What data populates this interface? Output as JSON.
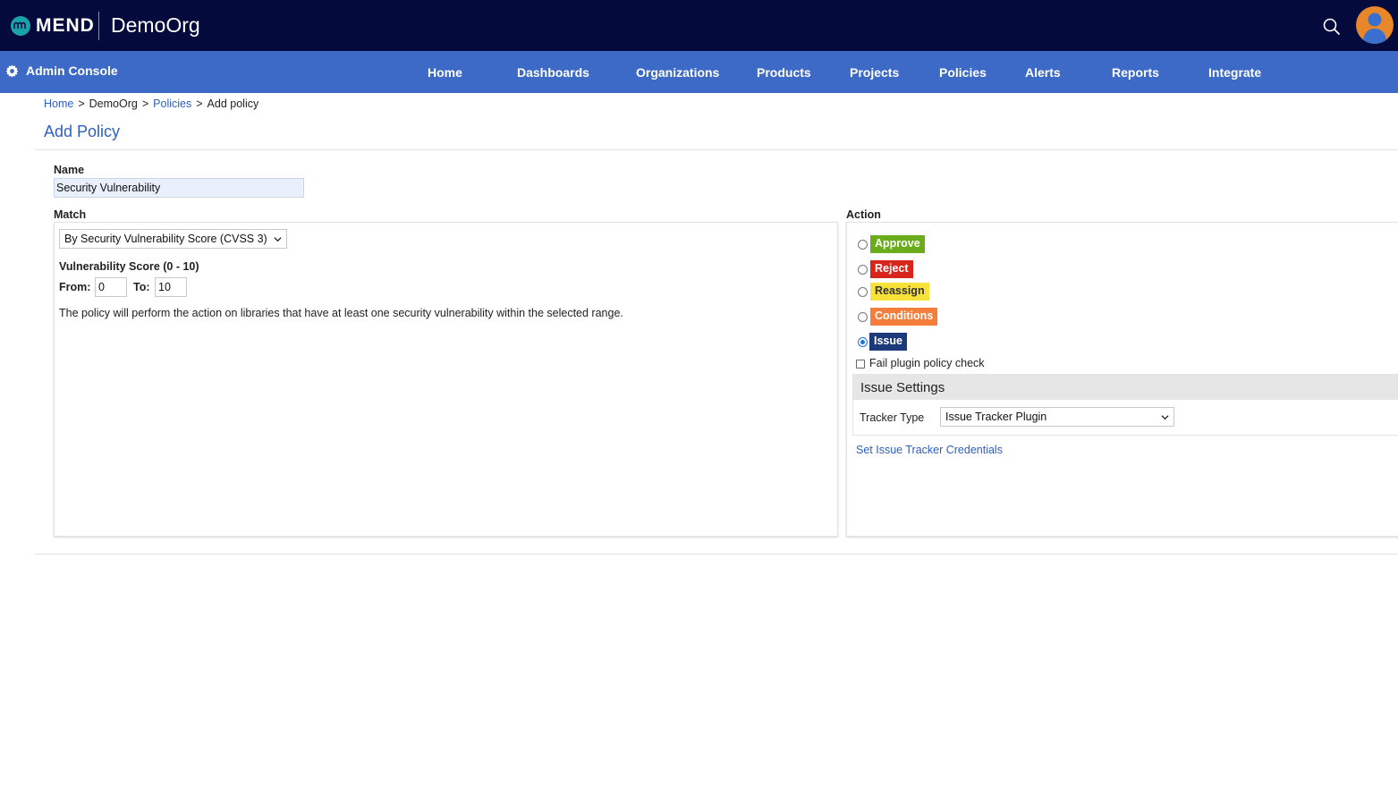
{
  "header": {
    "logo_text": "MEND",
    "org_name": "DemoOrg"
  },
  "navbar": {
    "admin_label": "Admin Console",
    "items": [
      "Home",
      "Dashboards",
      "Organizations",
      "Products",
      "Projects",
      "Policies",
      "Alerts",
      "Reports",
      "Integrate"
    ]
  },
  "breadcrumb": {
    "items": [
      "Home",
      "DemoOrg",
      "Policies",
      "Add policy"
    ],
    "separator": ">"
  },
  "page": {
    "title": "Add Policy"
  },
  "form": {
    "name_label": "Name",
    "name_value": "Security Vulnerability",
    "match_label": "Match",
    "match_select": "By Security Vulnerability Score (CVSS 3)",
    "score_label": "Vulnerability Score (0 - 10)",
    "from_label": "From:",
    "from_value": "0",
    "to_label": "To:",
    "to_value": "10",
    "description": "The policy will perform the action on libraries that have at least one security vulnerability within the selected range."
  },
  "action": {
    "label": "Action",
    "options": [
      {
        "label": "Approve",
        "color": "#6aac1a",
        "text_color": "#ffffff",
        "selected": false
      },
      {
        "label": "Reject",
        "color": "#d8261c",
        "text_color": "#ffffff",
        "selected": false
      },
      {
        "label": "Reassign",
        "color": "#f7e23a",
        "text_color": "#333333",
        "selected": false
      },
      {
        "label": "Conditions",
        "color": "#f57f3a",
        "text_color": "#ffffff",
        "selected": false
      },
      {
        "label": "Issue",
        "color": "#1c3a7a",
        "text_color": "#ffffff",
        "selected": true
      }
    ],
    "fail_check_label": "Fail plugin policy check",
    "fail_check_checked": false
  },
  "issue_settings": {
    "title": "Issue Settings",
    "tracker_label": "Tracker Type",
    "tracker_value": "Issue Tracker Plugin",
    "credentials_link": "Set Issue Tracker Credentials"
  },
  "colors": {
    "topbar": "#050a3c",
    "navbar": "#3d6ac6",
    "link": "#2f5fbf"
  }
}
